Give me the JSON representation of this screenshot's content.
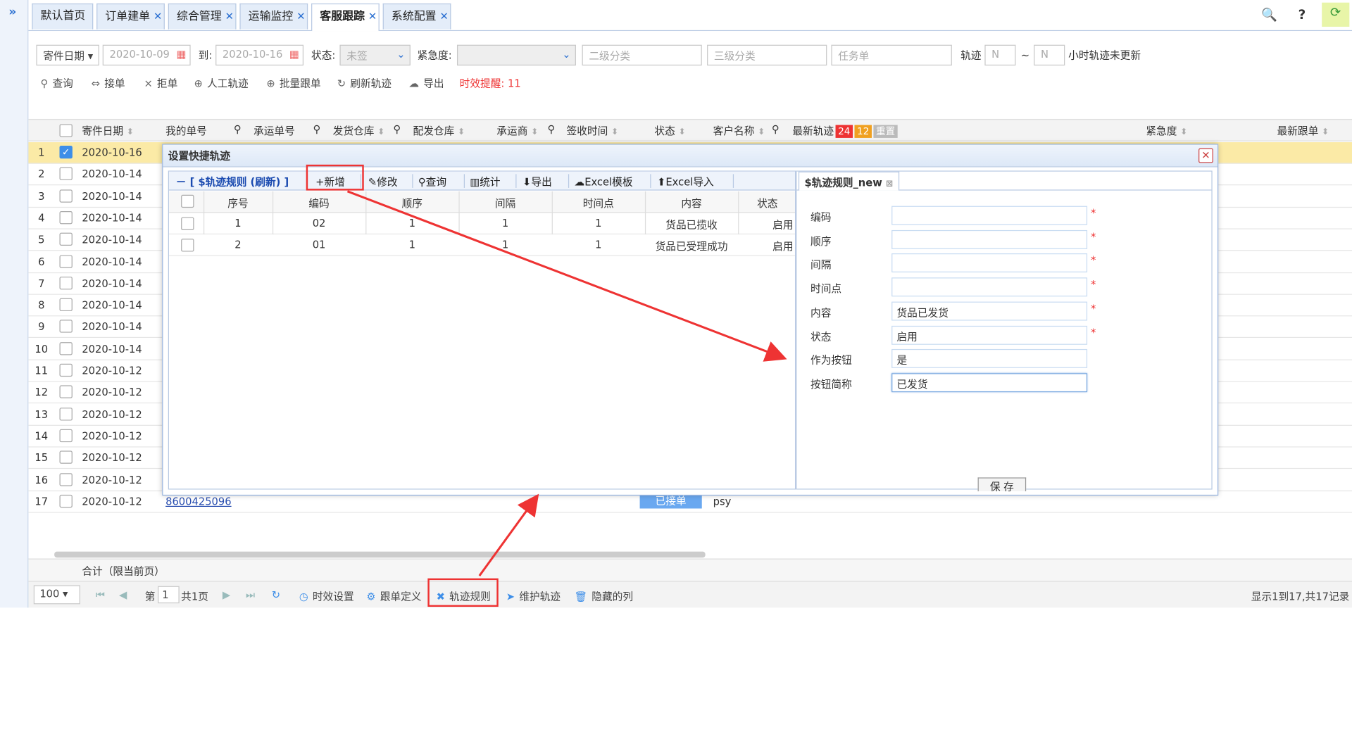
{
  "tabs": [
    {
      "label": "默认首页",
      "closable": false
    },
    {
      "label": "订单建单",
      "closable": true
    },
    {
      "label": "综合管理",
      "closable": true
    },
    {
      "label": "运输监控",
      "closable": true
    },
    {
      "label": "客服跟踪",
      "closable": true,
      "active": true
    },
    {
      "label": "系统配置",
      "closable": true
    }
  ],
  "filters": {
    "date_type": "寄件日期",
    "date_from": "2020-10-09",
    "to_label": "到:",
    "date_to": "2020-10-16",
    "status_label": "状态:",
    "status_value": "未签",
    "urgency_label": "紧急度:",
    "urgency_value": "",
    "level2_placeholder": "二级分类",
    "level3_placeholder": "三级分类",
    "task_placeholder": "任务单",
    "track_label": "轨迹",
    "n1_placeholder": "N",
    "tilde": "~",
    "n2_placeholder": "N",
    "hours_label": "小时轨迹未更新"
  },
  "actions": [
    {
      "icon": "search-icon",
      "label": "查询"
    },
    {
      "icon": "link-icon",
      "label": "接单"
    },
    {
      "icon": "close-icon",
      "label": "拒单"
    },
    {
      "icon": "plus-circle-icon",
      "label": "人工轨迹"
    },
    {
      "icon": "plus-circle-icon",
      "label": "批量跟单"
    },
    {
      "icon": "refresh-icon",
      "label": "刷新轨迹"
    },
    {
      "icon": "cloud-download-icon",
      "label": "导出"
    },
    {
      "icon": "",
      "label": "时效提醒: 11"
    }
  ],
  "grid": {
    "headers": [
      "寄件日期",
      "我的单号",
      "承运单号",
      "发货仓库",
      "配发仓库",
      "承运商",
      "签收时间",
      "状态",
      "客户名称",
      "最新轨迹",
      "紧急度",
      "最新跟单"
    ],
    "badge_red": "24",
    "badge_orange": "12",
    "badge_gray": "重置",
    "rows": [
      {
        "n": "1",
        "date": "2020-10-16",
        "checked": true
      },
      {
        "n": "2",
        "date": "2020-10-14"
      },
      {
        "n": "3",
        "date": "2020-10-14"
      },
      {
        "n": "4",
        "date": "2020-10-14"
      },
      {
        "n": "5",
        "date": "2020-10-14"
      },
      {
        "n": "6",
        "date": "2020-10-14"
      },
      {
        "n": "7",
        "date": "2020-10-14"
      },
      {
        "n": "8",
        "date": "2020-10-14"
      },
      {
        "n": "9",
        "date": "2020-10-14"
      },
      {
        "n": "10",
        "date": "2020-10-14"
      },
      {
        "n": "11",
        "date": "2020-10-12"
      },
      {
        "n": "12",
        "date": "2020-10-12"
      },
      {
        "n": "13",
        "date": "2020-10-12"
      },
      {
        "n": "14",
        "date": "2020-10-12"
      },
      {
        "n": "15",
        "date": "2020-10-12"
      },
      {
        "n": "16",
        "date": "2020-10-12"
      },
      {
        "n": "17",
        "date": "2020-10-12"
      }
    ],
    "row17_order": "8600425096",
    "row17_status": "已接单",
    "row17_customer": "psy",
    "sum_label": "合计（限当前页）"
  },
  "pager": {
    "page_size": "100",
    "page_prefix": "第",
    "page_num": "1",
    "page_total": "共1页",
    "items": [
      {
        "icon": "clock-icon",
        "label": "时效设置"
      },
      {
        "icon": "gear-icon",
        "label": "跟单定义"
      },
      {
        "icon": "tools-icon",
        "label": "轨迹规则"
      },
      {
        "icon": "send-icon",
        "label": "维护轨迹"
      },
      {
        "icon": "trash-icon",
        "label": "隐藏的列"
      }
    ],
    "summary": "显示1到17,共17记录"
  },
  "dialog": {
    "title": "设置快捷轨迹",
    "left_title": "－ [ $轨迹规则 (刷新) ]",
    "toolbar": [
      "+新增",
      "修改",
      "查询",
      "统计",
      "导出",
      "Excel模板",
      "Excel导入"
    ],
    "columns": [
      "序号",
      "编码",
      "顺序",
      "间隔",
      "时间点",
      "内容",
      "状态"
    ],
    "rows": [
      {
        "seq": "1",
        "code": "02",
        "order": "1",
        "interval": "1",
        "time": "1",
        "content": "货品已揽收",
        "status": "启用"
      },
      {
        "seq": "2",
        "code": "01",
        "order": "1",
        "interval": "1",
        "time": "1",
        "content": "货品已受理成功",
        "status": "启用"
      }
    ],
    "right_tab": "$轨迹规则_new",
    "form": [
      {
        "label": "编码",
        "value": "",
        "required": true
      },
      {
        "label": "顺序",
        "value": "",
        "required": true
      },
      {
        "label": "间隔",
        "value": "",
        "required": true
      },
      {
        "label": "时间点",
        "value": "",
        "required": true
      },
      {
        "label": "内容",
        "value": "货品已发货",
        "required": true
      },
      {
        "label": "状态",
        "value": "启用",
        "required": true
      },
      {
        "label": "作为按钮",
        "value": "是",
        "required": false
      },
      {
        "label": "按钮简称",
        "value": "已发货",
        "required": false
      }
    ],
    "save": "保 存"
  },
  "colors": {
    "accent": "#3d8ee8",
    "annotation": "#e33333",
    "selected_row": "#fbeaa6"
  }
}
